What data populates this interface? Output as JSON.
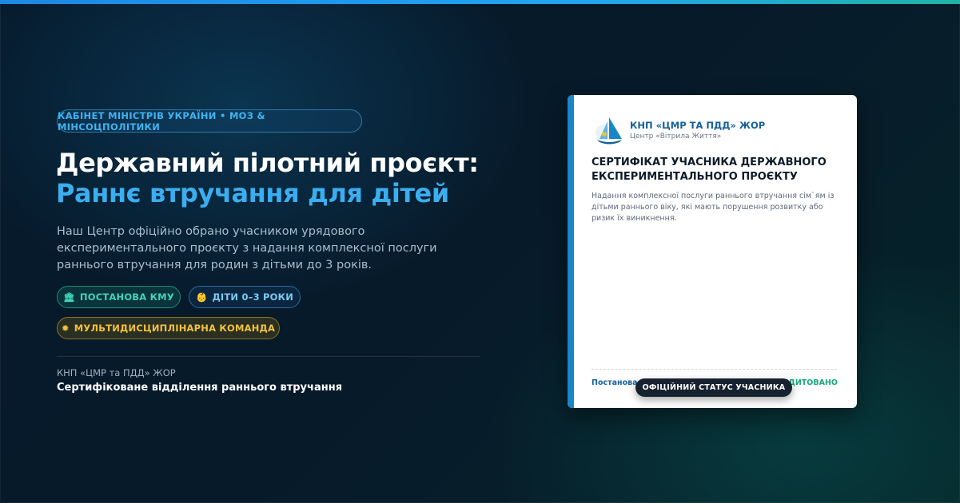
{
  "header": {
    "badge": "КАБІНЕТ МІНІСТРІВ УКРАЇНИ • МОЗ & МІНСОЦПОЛІТИКИ",
    "title_line1": "Державний пілотний проєкт:",
    "title_line2": "Раннє втручання для дітей",
    "description": "Наш Центр офіційно обрано учасником урядового експериментального проєкту з надання комплексної послуги раннього втручання для родин з дітьми до 3 років."
  },
  "chips": [
    {
      "icon": "🏛",
      "label": "ПОСТАНОВА КМУ"
    },
    {
      "icon": "👶",
      "label": "ДІТИ 0–3 РОКИ"
    },
    {
      "icon": "✹",
      "label": "МУЛЬТИДИСЦИПЛІНАРНА КОМАНДА"
    }
  ],
  "org": {
    "name": "КНП «ЦМР та ПДД» ЖОР",
    "subtitle": "Сертифіковане відділення раннього втручання"
  },
  "certificate": {
    "org_name": "КНП «ЦМР ТА ПДД» ЖОР",
    "org_sub": "Центр «Вітрила Життя»",
    "title": "СЕРТИФІКАТ УЧАСНИКА ДЕРЖАВНОГО ЕКСПЕРИМЕНТАЛЬНОГО ПРОЄКТУ",
    "text": "Надання комплексної послуги раннього втручання сім`ям із дітьми раннього віку, які мають порушення розвитку або ризик їх виникнення.",
    "footer_left": "Постанова КМУ",
    "footer_right": "АКРЕДИТОВАНО",
    "status": "ОФІЦІЙНИЙ СТАТУС УЧАСНИКА"
  },
  "colors": {
    "accent_blue": "#3aaef0",
    "teal": "#3fd6b8",
    "gold": "#f2c23a",
    "card_accent": "#1a86c8",
    "success": "#1aa77a"
  },
  "icons": [
    "bank-icon",
    "baby-icon",
    "sun-icon",
    "sailboat-logo-icon"
  ]
}
